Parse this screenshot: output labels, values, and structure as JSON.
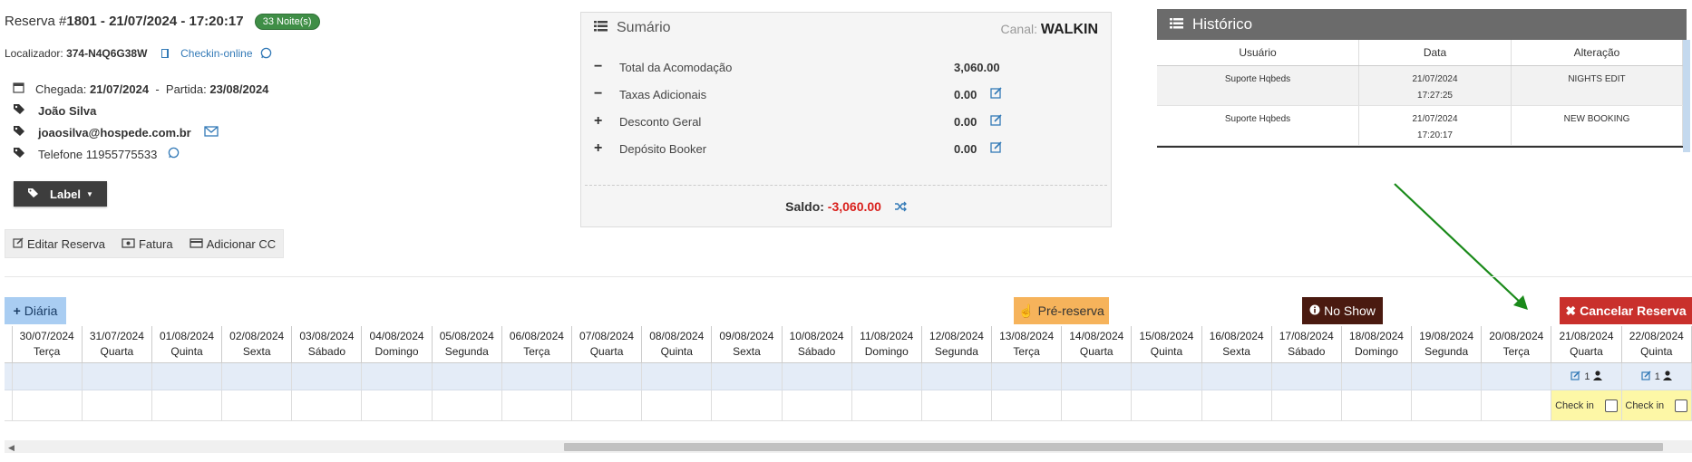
{
  "reservation": {
    "prefix": "Reserva #",
    "number": "1801",
    "datetime": "- 21/07/2024 - 17:20:17",
    "nights_badge": "33 Noite(s)",
    "locator_label": "Localizador:",
    "locator_value": "374-N4Q6G38W",
    "checkin_online": "Checkin-online",
    "arrival_label": "Chegada:",
    "arrival_value": "21/07/2024",
    "dash": "-",
    "departure_label": "Partida:",
    "departure_value": "23/08/2024",
    "guest_name": "João Silva",
    "guest_email": "joaosilva@hospede.com.br",
    "phone": "Telefone 11955775533",
    "label_button": "Label"
  },
  "toolbar": {
    "edit": "Editar Reserva",
    "invoice": "Fatura",
    "add_cc": "Adicionar CC"
  },
  "summary": {
    "title": "Sumário",
    "channel_label": "Canal:",
    "channel_value": "WALKIN",
    "rows": [
      {
        "sign": "−",
        "label": "Total da Acomodação",
        "value": "3,060.00",
        "editable": false
      },
      {
        "sign": "−",
        "label": "Taxas Adicionais",
        "value": "0.00",
        "editable": true
      },
      {
        "sign": "+",
        "label": "Desconto Geral",
        "value": "0.00",
        "editable": true
      },
      {
        "sign": "+",
        "label": "Depósito Booker",
        "value": "0.00",
        "editable": true
      }
    ],
    "balance_label": "Saldo:",
    "balance_value": "-3,060.00"
  },
  "history": {
    "title": "Histórico",
    "columns": [
      "Usuário",
      "Data",
      "Alteração"
    ],
    "rows": [
      {
        "user": "Suporte Hqbeds",
        "date": "21/07/2024",
        "time": "17:27:25",
        "change": "NIGHTS EDIT"
      },
      {
        "user": "Suporte Hqbeds",
        "date": "21/07/2024",
        "time": "17:20:17",
        "change": "NEW BOOKING"
      }
    ]
  },
  "actions": {
    "daily": "Diária",
    "pre_booking": "Pré-reserva",
    "no_show": "No Show",
    "cancel": "Cancelar Reserva"
  },
  "grid": {
    "days": [
      {
        "date": "30/07/2024",
        "weekday": "Terça"
      },
      {
        "date": "31/07/2024",
        "weekday": "Quarta"
      },
      {
        "date": "01/08/2024",
        "weekday": "Quinta"
      },
      {
        "date": "02/08/2024",
        "weekday": "Sexta"
      },
      {
        "date": "03/08/2024",
        "weekday": "Sábado"
      },
      {
        "date": "04/08/2024",
        "weekday": "Domingo"
      },
      {
        "date": "05/08/2024",
        "weekday": "Segunda"
      },
      {
        "date": "06/08/2024",
        "weekday": "Terça"
      },
      {
        "date": "07/08/2024",
        "weekday": "Quarta"
      },
      {
        "date": "08/08/2024",
        "weekday": "Quinta"
      },
      {
        "date": "09/08/2024",
        "weekday": "Sexta"
      },
      {
        "date": "10/08/2024",
        "weekday": "Sábado"
      },
      {
        "date": "11/08/2024",
        "weekday": "Domingo"
      },
      {
        "date": "12/08/2024",
        "weekday": "Segunda"
      },
      {
        "date": "13/08/2024",
        "weekday": "Terça"
      },
      {
        "date": "14/08/2024",
        "weekday": "Quarta"
      },
      {
        "date": "15/08/2024",
        "weekday": "Quinta"
      },
      {
        "date": "16/08/2024",
        "weekday": "Sexta"
      },
      {
        "date": "17/08/2024",
        "weekday": "Sábado"
      },
      {
        "date": "18/08/2024",
        "weekday": "Domingo"
      },
      {
        "date": "19/08/2024",
        "weekday": "Segunda"
      },
      {
        "date": "20/08/2024",
        "weekday": "Terça"
      },
      {
        "date": "21/08/2024",
        "weekday": "Quarta"
      },
      {
        "date": "22/08/2024",
        "weekday": "Quinta"
      }
    ],
    "guest_count": "1",
    "checkin_label": "Check in"
  },
  "colors": {
    "accent_link": "#337ab7",
    "badge_green": "#3f8e46",
    "negative": "#d9201c",
    "cancel": "#c9302c",
    "pre_booking": "#f6b35b",
    "no_show": "#4a1a10",
    "daily": "#a9cdf2",
    "checkin_cell": "#fdf7a6",
    "arrow": "#1a8a1a"
  }
}
